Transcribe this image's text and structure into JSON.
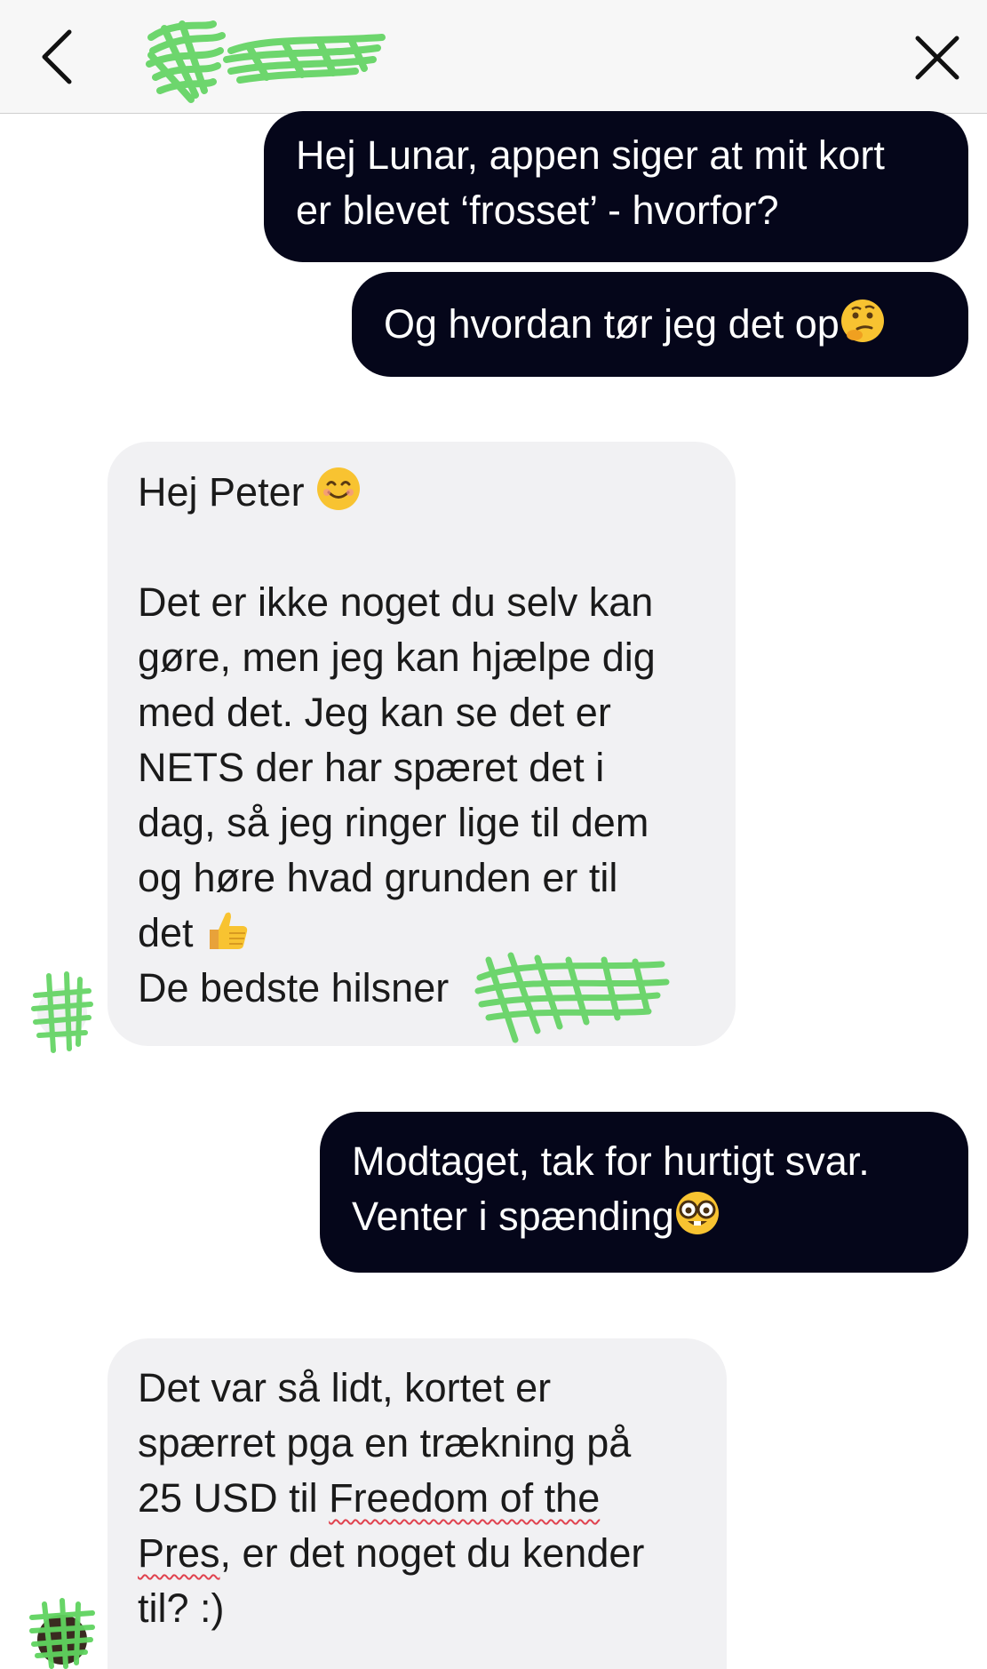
{
  "header": {
    "back_icon": "chevron-left-icon",
    "close_icon": "close-icon",
    "contact_name_redacted": true
  },
  "messages": [
    {
      "sender": "user",
      "text": "Hej Lunar, appen siger at mit kort\ner blevet ‘frosset’ - hvorfor?"
    },
    {
      "sender": "user",
      "text": "Og hvordan tør jeg det op",
      "emoji": "thinking-face-icon"
    },
    {
      "sender": "agent",
      "greeting": "Hej Peter",
      "greeting_emoji": "smiling-face-icon",
      "body": "Det er ikke noget du selv kan\ngøre, men jeg kan hjælpe dig\nmed det. Jeg kan se det er\nNETS der har spæret det i\ndag, så jeg ringer lige til dem\nog høre hvad grunden er til\ndet",
      "body_emoji": "thumbs-up-icon",
      "signoff": "De bedste hilsner"
    },
    {
      "sender": "user",
      "text": "Modtaget, tak for hurtigt svar.\nVenter i spænding",
      "emoji": "nerd-face-icon"
    },
    {
      "sender": "agent",
      "text_before": "Det var så lidt, kortet er\nspærret pga en trækning på\n25 USD til ",
      "underlined_1": "Freedom of the",
      "underlined_2": "Pres",
      "text_after": ", er det noget du kender\ntil? :)"
    }
  ],
  "colors": {
    "outgoing_bubble": "#05061a",
    "incoming_bubble": "#f1f1f3",
    "redaction": "#5fd35f",
    "spellcheck": "#e0434f"
  }
}
